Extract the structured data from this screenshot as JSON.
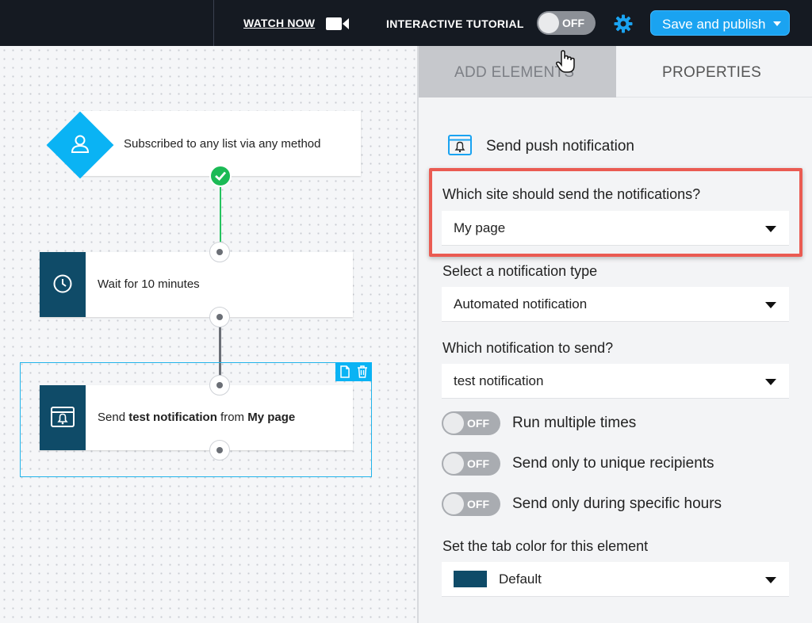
{
  "topbar": {
    "watch_now": "WATCH NOW",
    "tutorial_label": "INTERACTIVE TUTORIAL",
    "tutorial_toggle": "OFF",
    "publish_label": "Save and publish"
  },
  "workflow": {
    "trigger_text": "Subscribed to any list via any method",
    "wait_text": "Wait for 10 minutes",
    "send": {
      "prefix": "Send ",
      "notification": "test notification",
      "middle": " from ",
      "page": "My page"
    }
  },
  "panel": {
    "tabs": {
      "add": "ADD ELEMENTS",
      "properties": "PROPERTIES"
    },
    "title": "Send push notification",
    "site_label": "Which site should send the notifications?",
    "site_value": "My page",
    "type_label": "Select a notification type",
    "type_value": "Automated notification",
    "which_label": "Which notification to send?",
    "which_value": "test notification",
    "toggles": [
      {
        "state": "OFF",
        "label": "Run multiple times"
      },
      {
        "state": "OFF",
        "label": "Send only to unique recipients"
      },
      {
        "state": "OFF",
        "label": "Send only during specific hours"
      }
    ],
    "color_label": "Set the tab color for this element",
    "color_value": "Default"
  },
  "colors": {
    "accent": "#1aa3f1",
    "diamond": "#0ab3f4",
    "step_tab": "#0f4b68",
    "success": "#1bba55",
    "highlight": "#ea5b52"
  }
}
